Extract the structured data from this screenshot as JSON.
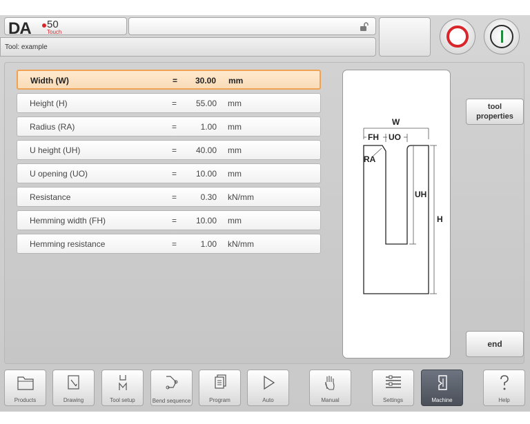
{
  "header": {
    "logo_main": "DA",
    "logo_number": "50",
    "logo_sub": "Touch",
    "title_text": "",
    "tool_label": "Tool: example"
  },
  "params": [
    {
      "label": "Width (W)",
      "eq": "=",
      "value": "30.00",
      "unit": "mm",
      "selected": true
    },
    {
      "label": "Height (H)",
      "eq": "=",
      "value": "55.00",
      "unit": "mm"
    },
    {
      "label": "Radius (RA)",
      "eq": "=",
      "value": "1.00",
      "unit": "mm"
    },
    {
      "label": "U height (UH)",
      "eq": "=",
      "value": "40.00",
      "unit": "mm"
    },
    {
      "label": "U opening (UO)",
      "eq": "=",
      "value": "10.00",
      "unit": "mm"
    },
    {
      "label": "Resistance",
      "eq": "=",
      "value": "0.30",
      "unit": "kN/mm"
    },
    {
      "label": "Hemming width (FH)",
      "eq": "=",
      "value": "10.00",
      "unit": "mm"
    },
    {
      "label": "Hemming resistance",
      "eq": "=",
      "value": "1.00",
      "unit": "kN/mm"
    }
  ],
  "diagram": {
    "w": "W",
    "fh": "FH",
    "uo": "UO",
    "ra": "RA",
    "uh": "UH",
    "h": "H"
  },
  "side_buttons": {
    "tool_properties_line1": "tool",
    "tool_properties_line2": "properties",
    "end": "end"
  },
  "nav": [
    {
      "label": "Products",
      "icon": "folder-icon"
    },
    {
      "label": "Drawing",
      "icon": "pencil-icon"
    },
    {
      "label": "Tool setup",
      "icon": "tool-setup-icon"
    },
    {
      "label": "Bend sequence",
      "icon": "bend-sequence-icon"
    },
    {
      "label": "Program",
      "icon": "program-pages-icon"
    },
    {
      "label": "Auto",
      "icon": "play-icon"
    },
    {
      "label": "Manual",
      "icon": "hand-icon"
    },
    {
      "label": "Settings",
      "icon": "settings-list-icon"
    },
    {
      "label": "Machine",
      "icon": "machine-icon",
      "active": true
    },
    {
      "label": "Help",
      "icon": "question-icon"
    }
  ],
  "colors": {
    "accent_selected": "#f0a254",
    "stop_red": "#d8262a",
    "start_green": "#1e8c3a"
  }
}
